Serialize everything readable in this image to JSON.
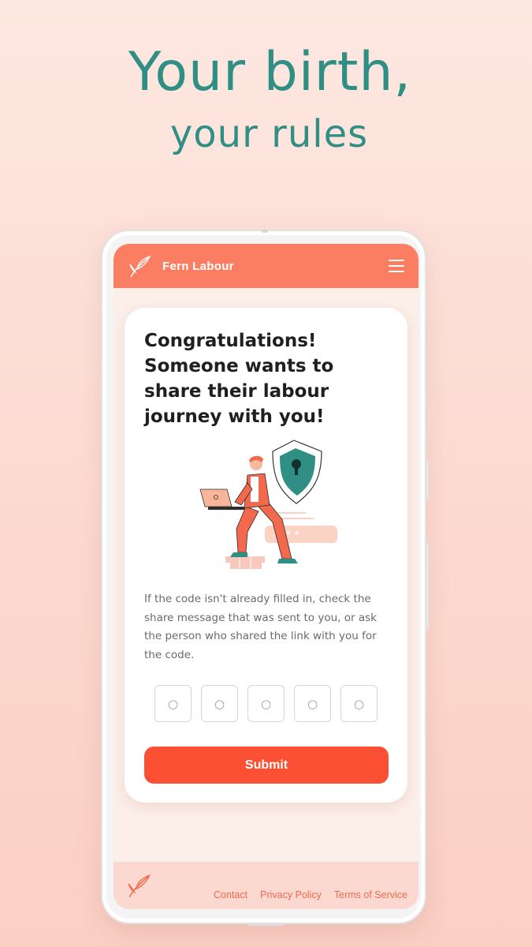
{
  "hero": {
    "line1": "Your birth,",
    "line2": "your rules"
  },
  "app": {
    "brand": "Fern Labour",
    "logo_icon": "fern-leaf-icon",
    "menu_icon": "hamburger-menu-icon",
    "colors": {
      "header": "#fb7e62",
      "accent": "#fc5034",
      "hero_text": "#2f8f84",
      "shield": "#2f8f84"
    }
  },
  "card": {
    "title": "Congratulations! Someone wants to share their labour journey with you!",
    "illustration": "person-with-laptop-and-security-shield-illustration",
    "body": "If the code isn't already filled in, check the share message that was sent to you, or ask the person who shared the link with you for the code.",
    "code_inputs": [
      {
        "placeholder": "○"
      },
      {
        "placeholder": "○"
      },
      {
        "placeholder": "○"
      },
      {
        "placeholder": "○"
      },
      {
        "placeholder": "○"
      }
    ],
    "submit_label": "Submit"
  },
  "footer": {
    "logo_icon": "fern-leaf-icon",
    "links": [
      "Contact",
      "Privacy Policy",
      "Terms of Service"
    ]
  }
}
